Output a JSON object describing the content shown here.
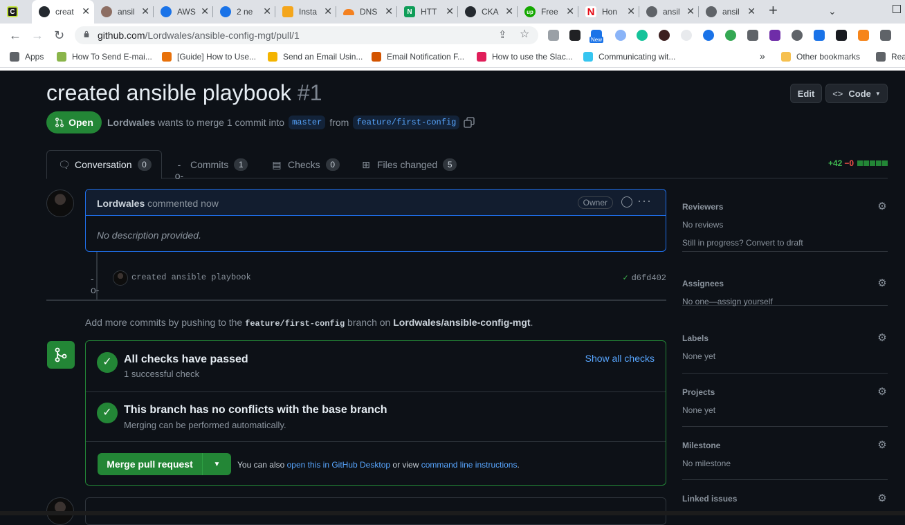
{
  "browser": {
    "tabs": [
      {
        "title": "",
        "fav_color": "#1b1b1b",
        "fav_char": "C"
      },
      {
        "title": "creat",
        "fav_color": "#24292f",
        "fav_char": "⬤"
      },
      {
        "title": "ansil",
        "fav_color": "#8d6e63",
        "fav_char": "☺"
      },
      {
        "title": "AWS",
        "fav_color": "#1a73e8",
        "fav_char": "d"
      },
      {
        "title": "2 ne",
        "fav_color": "#1a73e8",
        "fav_char": "d"
      },
      {
        "title": "Insta",
        "fav_color": "#f4a61c",
        "fav_char": "▣"
      },
      {
        "title": "DNS",
        "fav_color": "#f48120",
        "fav_char": "☁"
      },
      {
        "title": "HTT",
        "fav_color": "#0f9d58",
        "fav_char": "N"
      },
      {
        "title": "CKA",
        "fav_color": "#24292f",
        "fav_char": "⬤"
      },
      {
        "title": "Free",
        "fav_color": "#14a800",
        "fav_char": "up"
      },
      {
        "title": "Hon",
        "fav_color": "#e50914",
        "fav_char": "N"
      },
      {
        "title": "ansil",
        "fav_color": "#5f6368",
        "fav_char": "◍"
      },
      {
        "title": "ansil",
        "fav_color": "#5f6368",
        "fav_char": "◍"
      }
    ],
    "url_host": "github.com",
    "url_path": "/Lordwales/ansible-config-mgt/pull/1",
    "bookmarks": [
      {
        "label": "Apps",
        "color": "#5f6368"
      },
      {
        "label": "How To Send E-mai...",
        "color": "#8ab54a"
      },
      {
        "label": "[Guide] How to Use...",
        "color": "#e8710a"
      },
      {
        "label": "Send an Email Usin...",
        "color": "#f4b400"
      },
      {
        "label": "Email Notification F...",
        "color": "#d35400"
      },
      {
        "label": "How to use the Slac...",
        "color": "#e01e5a"
      },
      {
        "label": "Communicating wit...",
        "color": "#36c5f0"
      },
      {
        "label": "Other bookmarks",
        "color": "#f6c04f"
      },
      {
        "label": "Rea",
        "color": "#5f6368"
      }
    ],
    "more_bookmarks": "»",
    "new_badge": "New"
  },
  "pr": {
    "title": "created ansible playbook",
    "number": "#1",
    "edit_label": "Edit",
    "code_label": "Code",
    "state": "Open",
    "author": "Lordwales",
    "merge_text": "wants to merge 1 commit into",
    "base_branch": "master",
    "from_text": "from",
    "head_branch": "feature/first-config"
  },
  "tabs": [
    {
      "label": "Conversation",
      "count": "0"
    },
    {
      "label": "Commits",
      "count": "1"
    },
    {
      "label": "Checks",
      "count": "0"
    },
    {
      "label": "Files changed",
      "count": "5"
    }
  ],
  "diffstat": {
    "additions": "+42",
    "deletions": "−0"
  },
  "comment": {
    "author": "Lordwales",
    "time": "commented now",
    "badge": "Owner",
    "body": "No description provided."
  },
  "commit": {
    "message": "created ansible playbook",
    "sha": "d6fd402"
  },
  "hint": {
    "prefix": "Add more commits by pushing to the",
    "branch": "feature/first-config",
    "middle": "branch on",
    "repo": "Lordwales/ansible-config-mgt",
    "suffix": "."
  },
  "merge": {
    "checks_title": "All checks have passed",
    "checks_sub": "1 successful check",
    "show_checks": "Show all checks",
    "conflict_title": "This branch has no conflicts with the base branch",
    "conflict_sub": "Merging can be performed automatically.",
    "button": "Merge pull request",
    "also_prefix": "You can also",
    "desktop_link": "open this in GitHub Desktop",
    "or_view": "or view",
    "cli_link": "command line instructions",
    "also_suffix": "."
  },
  "sidebar": [
    {
      "heading": "Reviewers",
      "values": [
        "No reviews",
        "Still in progress? Convert to draft"
      ]
    },
    {
      "heading": "Assignees",
      "values": [
        "No one—assign yourself"
      ]
    },
    {
      "heading": "Labels",
      "values": [
        "None yet"
      ]
    },
    {
      "heading": "Projects",
      "values": [
        "None yet"
      ]
    },
    {
      "heading": "Milestone",
      "values": [
        "No milestone"
      ]
    },
    {
      "heading": "Linked issues",
      "values": []
    }
  ]
}
